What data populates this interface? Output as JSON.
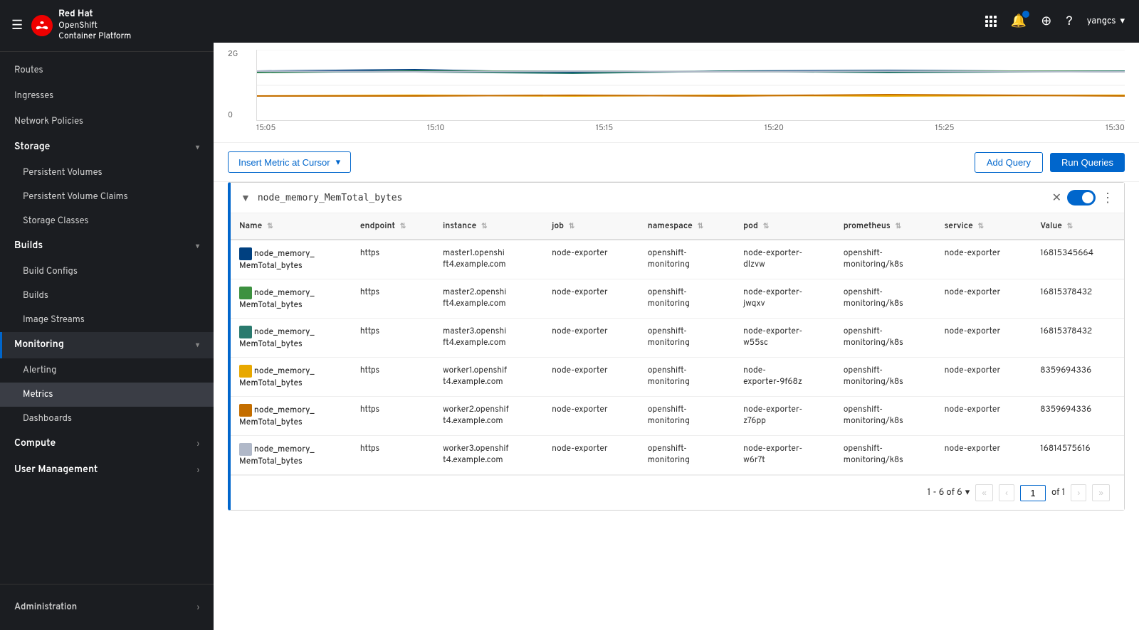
{
  "app": {
    "title": "Red Hat OpenShift Container Platform",
    "brand": "Red Hat",
    "product_line1": "OpenShift",
    "product_line2": "Container Platform"
  },
  "topbar": {
    "user": "yangcs",
    "chevron": "▾"
  },
  "sidebar": {
    "sections": [
      {
        "label": "Routes",
        "type": "item",
        "indent": false
      },
      {
        "label": "Ingresses",
        "type": "item",
        "indent": false
      },
      {
        "label": "Network Policies",
        "type": "item",
        "indent": false
      },
      {
        "label": "Storage",
        "type": "section",
        "expanded": true
      },
      {
        "label": "Persistent Volumes",
        "type": "sub"
      },
      {
        "label": "Persistent Volume Claims",
        "type": "sub"
      },
      {
        "label": "Storage Classes",
        "type": "sub"
      },
      {
        "label": "Builds",
        "type": "section",
        "expanded": true
      },
      {
        "label": "Build Configs",
        "type": "sub"
      },
      {
        "label": "Builds",
        "type": "sub"
      },
      {
        "label": "Image Streams",
        "type": "sub"
      },
      {
        "label": "Monitoring",
        "type": "section-active",
        "expanded": true
      },
      {
        "label": "Alerting",
        "type": "sub-monitoring"
      },
      {
        "label": "Metrics",
        "type": "sub-active"
      },
      {
        "label": "Dashboards",
        "type": "sub-monitoring"
      },
      {
        "label": "Compute",
        "type": "section-collapsed"
      },
      {
        "label": "User Management",
        "type": "section-collapsed"
      }
    ],
    "bottom": {
      "label": "Administration",
      "chevron": "›"
    }
  },
  "chart": {
    "y_labels": [
      "2G",
      "0"
    ],
    "x_labels": [
      "15:05",
      "15:10",
      "15:15",
      "15:20",
      "15:25",
      "15:30"
    ]
  },
  "query_bar": {
    "insert_metric_label": "Insert Metric at Cursor",
    "add_query_label": "Add Query",
    "run_queries_label": "Run Queries"
  },
  "query_block": {
    "query_text": "node_memory_MemTotal_bytes",
    "collapse_icon": "▼",
    "more_icon": "⋮"
  },
  "table": {
    "columns": [
      "Name",
      "endpoint",
      "instance",
      "job",
      "namespace",
      "pod",
      "prometheus",
      "service",
      "Value"
    ],
    "rows": [
      {
        "color": "#004080",
        "name": "node_memory_\nMemTotal_bytes",
        "name_line1": "node_memory_",
        "name_line2": "MemTotal_bytes",
        "endpoint": "https",
        "instance_line1": "master1.openshi",
        "instance_line2": "ft4.example.com",
        "job": "node-exporter",
        "namespace_line1": "openshift-",
        "namespace_line2": "monitoring",
        "pod_line1": "node-exporter-",
        "pod_line2": "dlzvw",
        "prometheus_line1": "openshift-",
        "prometheus_line2": "monitoring/k8s",
        "service": "node-exporter",
        "value": "16815345664"
      },
      {
        "color": "#3d9140",
        "name_line1": "node_memory_",
        "name_line2": "MemTotal_bytes",
        "endpoint": "https",
        "instance_line1": "master2.openshi",
        "instance_line2": "ft4.example.com",
        "job": "node-exporter",
        "namespace_line1": "openshift-",
        "namespace_line2": "monitoring",
        "pod_line1": "node-exporter-",
        "pod_line2": "jwqxv",
        "prometheus_line1": "openshift-",
        "prometheus_line2": "monitoring/k8s",
        "service": "node-exporter",
        "value": "16815378432"
      },
      {
        "color": "#2a7a6e",
        "name_line1": "node_memory_",
        "name_line2": "MemTotal_bytes",
        "endpoint": "https",
        "instance_line1": "master3.openshi",
        "instance_line2": "ft4.example.com",
        "job": "node-exporter",
        "namespace_line1": "openshift-",
        "namespace_line2": "monitoring",
        "pod_line1": "node-exporter-",
        "pod_line2": "w55sc",
        "prometheus_line1": "openshift-",
        "prometheus_line2": "monitoring/k8s",
        "service": "node-exporter",
        "value": "16815378432"
      },
      {
        "color": "#e8a800",
        "name_line1": "node_memory_",
        "name_line2": "MemTotal_bytes",
        "endpoint": "https",
        "instance_line1": "worker1.openshif",
        "instance_line2": "t4.example.com",
        "job": "node-exporter",
        "namespace_line1": "openshift-",
        "namespace_line2": "monitoring",
        "pod_line1": "node-",
        "pod_line2": "exporter-9f68z",
        "prometheus_line1": "openshift-",
        "prometheus_line2": "monitoring/k8s",
        "service": "node-exporter",
        "value": "8359694336"
      },
      {
        "color": "#c46e00",
        "name_line1": "node_memory_",
        "name_line2": "MemTotal_bytes",
        "endpoint": "https",
        "instance_line1": "worker2.openshif",
        "instance_line2": "t4.example.com",
        "job": "node-exporter",
        "namespace_line1": "openshift-",
        "namespace_line2": "monitoring",
        "pod_line1": "node-exporter-",
        "pod_line2": "z76pp",
        "prometheus_line1": "openshift-",
        "prometheus_line2": "monitoring/k8s",
        "service": "node-exporter",
        "value": "8359694336"
      },
      {
        "color": "#b0b8c8",
        "name_line1": "node_memory_",
        "name_line2": "MemTotal_bytes",
        "endpoint": "https",
        "instance_line1": "worker3.openshif",
        "instance_line2": "t4.example.com",
        "job": "node-exporter",
        "namespace_line1": "openshift-",
        "namespace_line2": "monitoring",
        "pod_line1": "node-exporter-",
        "pod_line2": "w6r7t",
        "prometheus_line1": "openshift-",
        "prometheus_line2": "monitoring/k8s",
        "service": "node-exporter",
        "value": "16814575616"
      }
    ]
  },
  "pagination": {
    "range_label": "1 - 6 of 6",
    "chevron": "▾",
    "first_label": "«",
    "prev_label": "‹",
    "current_page": "1",
    "of_label": "of 1",
    "next_label": "›",
    "last_label": "»"
  }
}
